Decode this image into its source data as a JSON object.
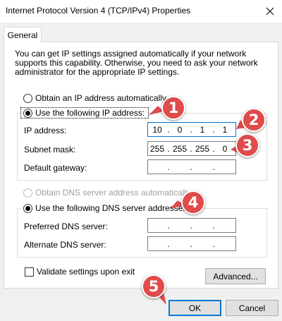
{
  "window": {
    "title": "Internet Protocol Version 4 (TCP/IPv4) Properties"
  },
  "tabs": [
    {
      "label": "General"
    }
  ],
  "general": {
    "description": "You can get IP settings assigned automatically if your network supports this capability. Otherwise, you need to ask your network administrator for the appropriate IP settings.",
    "ip_auto_label": "Obtain an IP address automatically",
    "ip_manual_label": "Use the following IP address:",
    "ip_mode": "manual",
    "fields": {
      "ip_address": {
        "label": "IP address:",
        "octets": [
          "10",
          "0",
          "1",
          "1"
        ]
      },
      "subnet_mask": {
        "label": "Subnet mask:",
        "octets": [
          "255",
          "255",
          "255",
          "0"
        ]
      },
      "default_gateway": {
        "label": "Default gateway:",
        "octets": [
          "",
          "",
          "",
          ""
        ]
      }
    },
    "dns_auto_label": "Obtain DNS server address automatically",
    "dns_manual_label": "Use the following DNS server addresses:",
    "dns_mode": "manual",
    "dns_fields": {
      "preferred": {
        "label": "Preferred DNS server:",
        "octets": [
          "",
          "",
          "",
          ""
        ]
      },
      "alternate": {
        "label": "Alternate DNS server:",
        "octets": [
          "",
          "",
          "",
          ""
        ]
      }
    },
    "validate_label": "Validate settings upon exit",
    "validate_checked": false,
    "advanced_label": "Advanced..."
  },
  "buttons": {
    "ok": "OK",
    "cancel": "Cancel"
  },
  "callouts": [
    "1",
    "2",
    "3",
    "4",
    "5"
  ],
  "colors": {
    "callout": "#e04b4b",
    "focus_border": "#0078d7",
    "client_bg": "#f0f0f0"
  },
  "icons": {
    "close": "close-icon",
    "radio": "radio-icon",
    "checkbox": "checkbox-icon"
  }
}
